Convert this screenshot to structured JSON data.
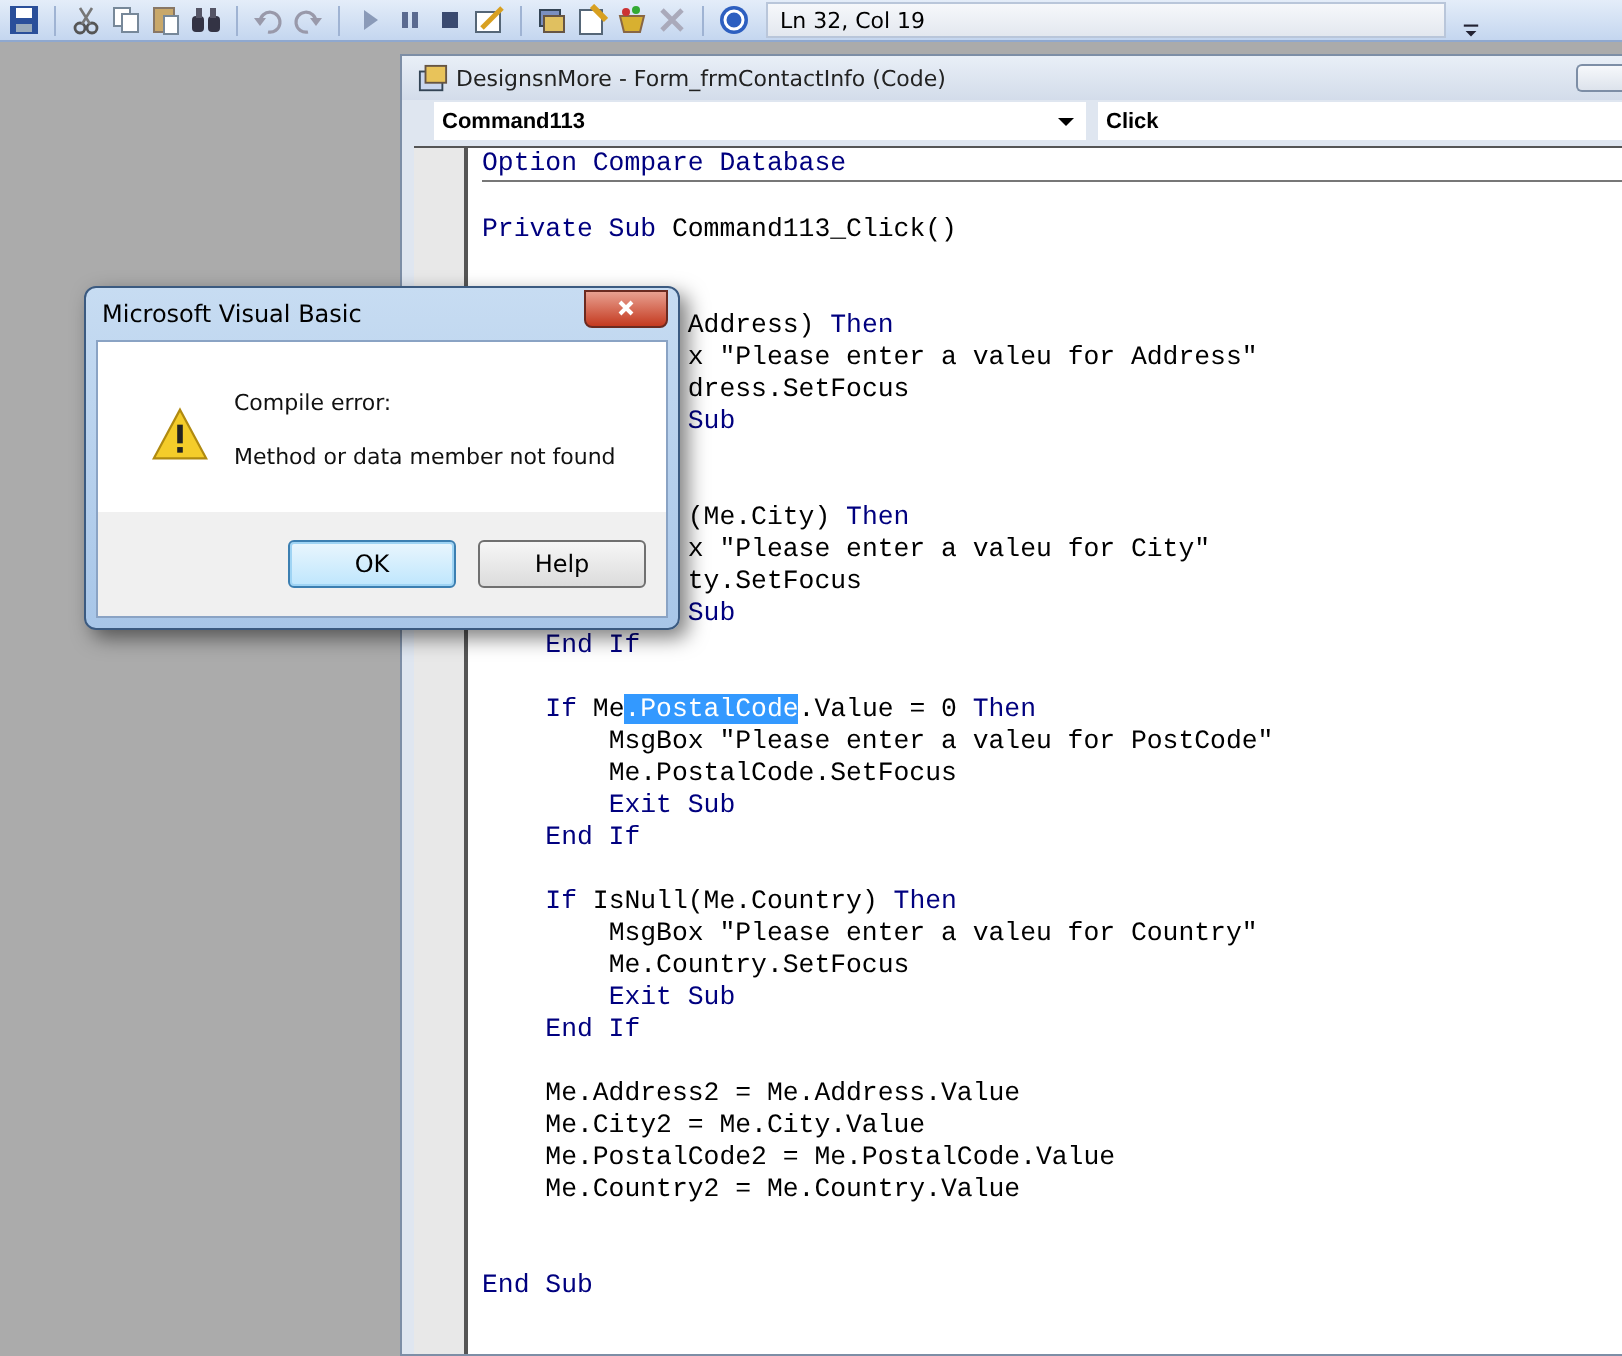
{
  "toolbar": {
    "position": "Ln 32, Col 19"
  },
  "code_window": {
    "title": "DesignsnMore - Form_frmContactInfo (Code)",
    "object_combo": "Command113",
    "procedure_combo": "Click",
    "header_line": [
      {
        "kind": "kw",
        "text": "Option Compare Database"
      }
    ],
    "lines": [
      {
        "kind": "blank"
      },
      [
        {
          "kind": "kw",
          "text": "Private Sub"
        },
        {
          "kind": "plain",
          "text": " Command113_Click()"
        }
      ],
      {
        "kind": "blank"
      },
      {
        "kind": "blank"
      },
      [
        {
          "kind": "plain",
          "text": "             Address) "
        },
        {
          "kind": "kw",
          "text": "Then"
        }
      ],
      [
        {
          "kind": "plain",
          "text": "             x \"Please enter a valeu for Address\""
        }
      ],
      [
        {
          "kind": "plain",
          "text": "             dress.SetFocus"
        }
      ],
      [
        {
          "kind": "kw",
          "text": "             Sub"
        }
      ],
      {
        "kind": "blank"
      },
      {
        "kind": "blank"
      },
      [
        {
          "kind": "plain",
          "text": "             (Me.City) "
        },
        {
          "kind": "kw",
          "text": "Then"
        }
      ],
      [
        {
          "kind": "plain",
          "text": "             x \"Please enter a valeu for City\""
        }
      ],
      [
        {
          "kind": "plain",
          "text": "             ty.SetFocus"
        }
      ],
      [
        {
          "kind": "kw",
          "text": "             Sub"
        }
      ],
      [
        {
          "kind": "kw",
          "text": "    End If"
        }
      ],
      {
        "kind": "blank"
      },
      [
        {
          "kind": "kw",
          "text": "    If"
        },
        {
          "kind": "plain",
          "text": " Me"
        },
        {
          "kind": "selected",
          "text": ".PostalCode"
        },
        {
          "kind": "plain",
          "text": ".Value = 0 "
        },
        {
          "kind": "kw",
          "text": "Then"
        }
      ],
      [
        {
          "kind": "plain",
          "text": "        MsgBox \"Please enter a valeu for PostCode\""
        }
      ],
      [
        {
          "kind": "plain",
          "text": "        Me.PostalCode.SetFocus"
        }
      ],
      [
        {
          "kind": "kw",
          "text": "        Exit Sub"
        }
      ],
      [
        {
          "kind": "kw",
          "text": "    End If"
        }
      ],
      {
        "kind": "blank"
      },
      [
        {
          "kind": "kw",
          "text": "    If"
        },
        {
          "kind": "plain",
          "text": " IsNull(Me.Country) "
        },
        {
          "kind": "kw",
          "text": "Then"
        }
      ],
      [
        {
          "kind": "plain",
          "text": "        MsgBox \"Please enter a valeu for Country\""
        }
      ],
      [
        {
          "kind": "plain",
          "text": "        Me.Country.SetFocus"
        }
      ],
      [
        {
          "kind": "kw",
          "text": "        Exit Sub"
        }
      ],
      [
        {
          "kind": "kw",
          "text": "    End If"
        }
      ],
      {
        "kind": "blank"
      },
      [
        {
          "kind": "plain",
          "text": "    Me.Address2 = Me.Address.Value"
        }
      ],
      [
        {
          "kind": "plain",
          "text": "    Me.City2 = Me.City.Value"
        }
      ],
      [
        {
          "kind": "plain",
          "text": "    Me.PostalCode2 = Me.PostalCode.Value"
        }
      ],
      [
        {
          "kind": "plain",
          "text": "    Me.Country2 = Me.Country.Value"
        }
      ],
      {
        "kind": "blank"
      },
      {
        "kind": "blank"
      },
      [
        {
          "kind": "kw",
          "text": "End Sub"
        }
      ]
    ]
  },
  "dialog": {
    "title": "Microsoft Visual Basic",
    "heading": "Compile error:",
    "message": "Method or data member not found",
    "buttons": [
      {
        "label": "OK",
        "selected": true
      },
      {
        "label": "Help",
        "selected": false
      }
    ]
  }
}
